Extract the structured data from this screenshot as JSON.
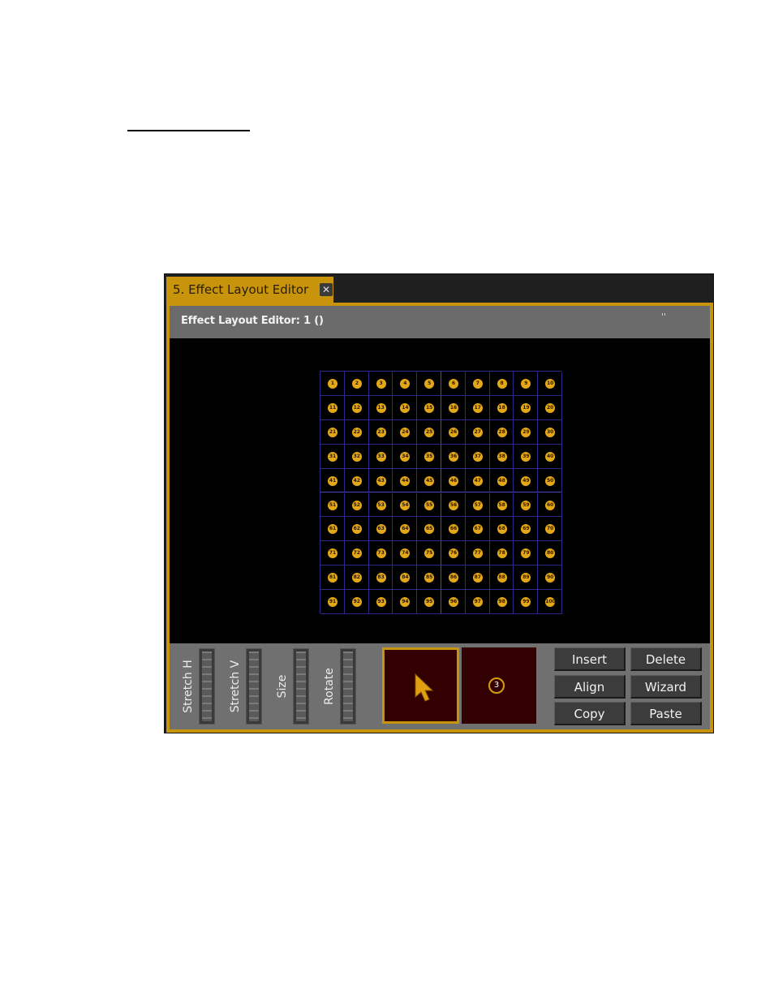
{
  "tab": {
    "label": "5. Effect Layout Editor",
    "close_glyph": "✕"
  },
  "editor": {
    "title": "Effect Layout Editor: 1 ()",
    "menu_glyph": "''"
  },
  "grid": {
    "rows": 10,
    "cols": 10,
    "count": 100,
    "fixture_color": "#e3a817",
    "line_color": "#2c2a86"
  },
  "sliders": [
    {
      "label": "Stretch H"
    },
    {
      "label": "Stretch V"
    },
    {
      "label": "Size"
    },
    {
      "label": "Rotate"
    }
  ],
  "modes": {
    "pointer_icon": "pointer-arrow-icon",
    "fixture_number": "3",
    "accent": "#c8940c",
    "bg": "#320000"
  },
  "buttons": {
    "insert": "Insert",
    "delete": "Delete",
    "align": "Align",
    "wizard": "Wizard",
    "copy": "Copy",
    "paste": "Paste"
  }
}
